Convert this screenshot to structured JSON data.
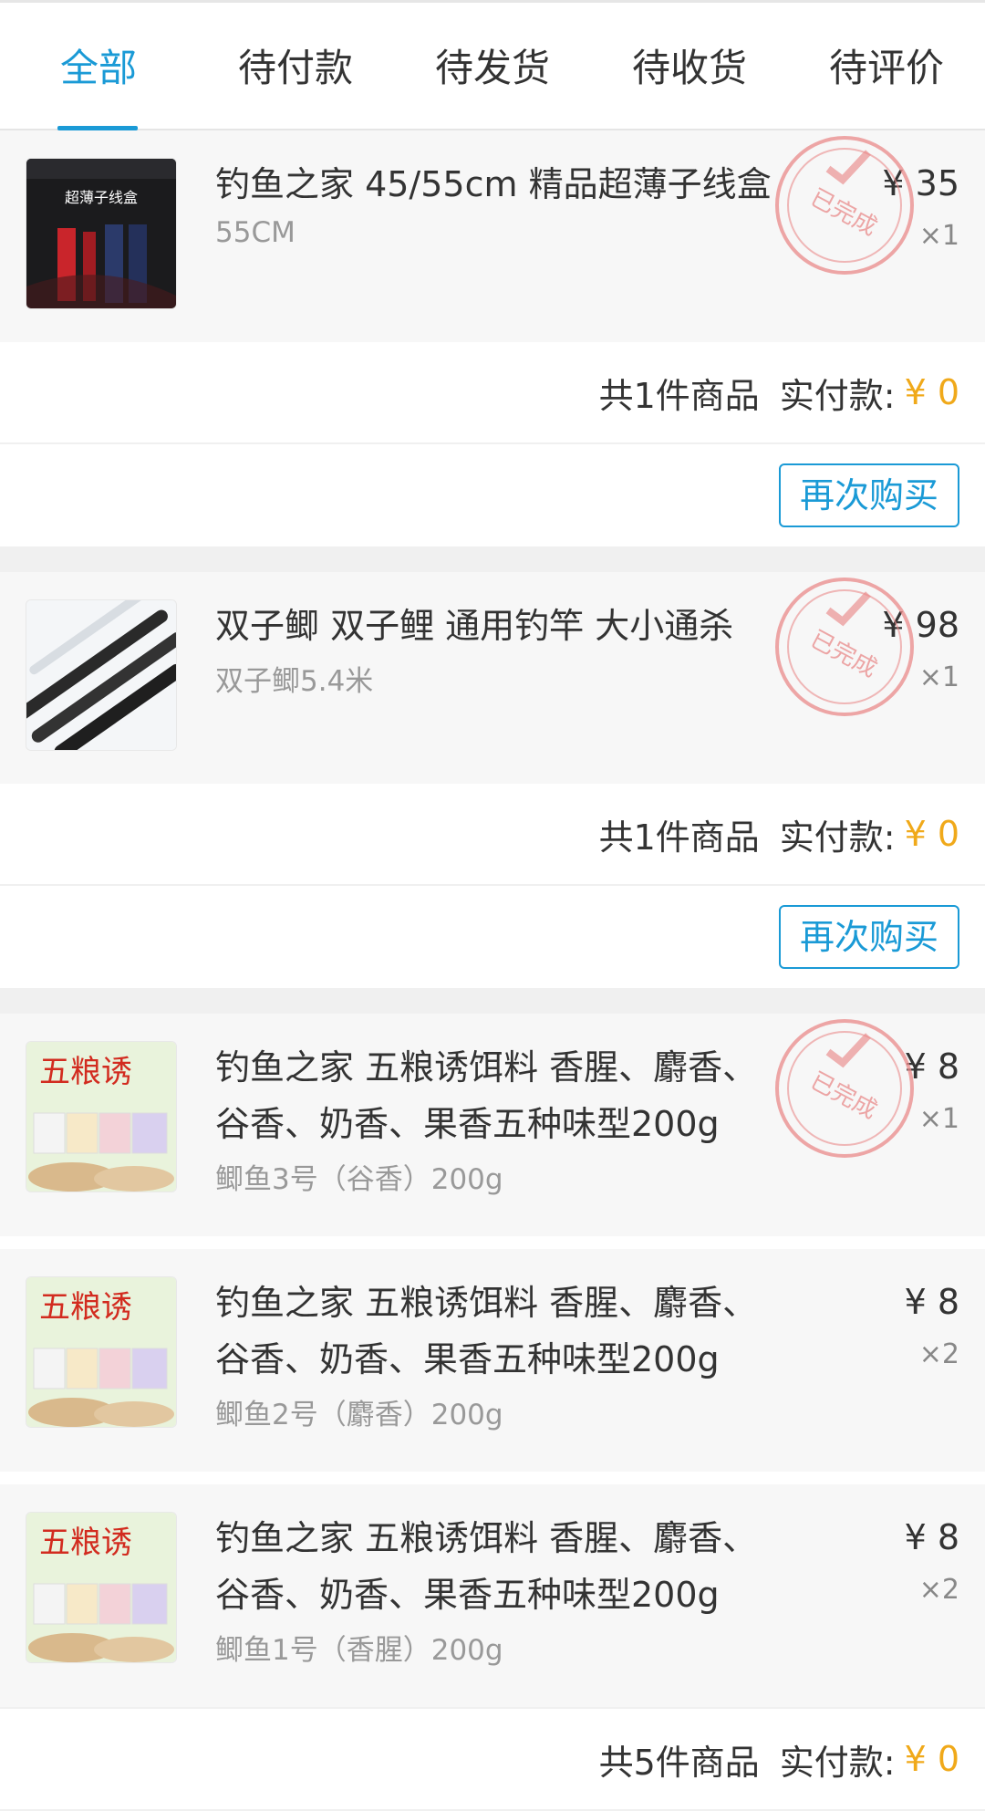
{
  "tabs": [
    {
      "label": "全部",
      "active": true
    },
    {
      "label": "待付款"
    },
    {
      "label": "待发货"
    },
    {
      "label": "待收货"
    },
    {
      "label": "待评价"
    }
  ],
  "stamp_text": "已完成",
  "currency": "¥",
  "colors": {
    "accent": "#1a9ad6",
    "price": "#f0a91a",
    "stamp": "#e98a8a"
  },
  "orders": [
    {
      "items": [
        {
          "title": "钓鱼之家 45/55cm 精品超薄子线盒",
          "spec": "55CM",
          "price": "¥ 35",
          "qty": "×1",
          "thumb_text": "超薄子线盒"
        }
      ],
      "summary": {
        "count": "共1件商品",
        "paid_label": "实付款:",
        "paid": "¥ 0"
      },
      "action": "再次购买"
    },
    {
      "items": [
        {
          "title": "双子鲫 双子鲤 通用钓竿 大小通杀",
          "spec": "双子鲫5.4米",
          "price": "¥ 98",
          "qty": "×1"
        }
      ],
      "summary": {
        "count": "共1件商品",
        "paid_label": "实付款:",
        "paid": "¥ 0"
      },
      "action": "再次购买"
    },
    {
      "items": [
        {
          "title": "钓鱼之家 五粮诱饵料 香腥、麝香、谷香、奶香、果香五种味型200g",
          "spec": "鲫鱼3号（谷香）200g",
          "price": "¥ 8",
          "qty": "×1",
          "thumb_text": "五粮诱"
        },
        {
          "title": "钓鱼之家 五粮诱饵料 香腥、麝香、谷香、奶香、果香五种味型200g",
          "spec": "鲫鱼2号（麝香）200g",
          "price": "¥ 8",
          "qty": "×2",
          "thumb_text": "五粮诱"
        },
        {
          "title": "钓鱼之家 五粮诱饵料 香腥、麝香、谷香、奶香、果香五种味型200g",
          "spec": "鲫鱼1号（香腥）200g",
          "price": "¥ 8",
          "qty": "×2",
          "thumb_text": "五粮诱"
        }
      ],
      "summary": {
        "count": "共5件商品",
        "paid_label": "实付款:",
        "paid": "¥ 0"
      }
    }
  ]
}
